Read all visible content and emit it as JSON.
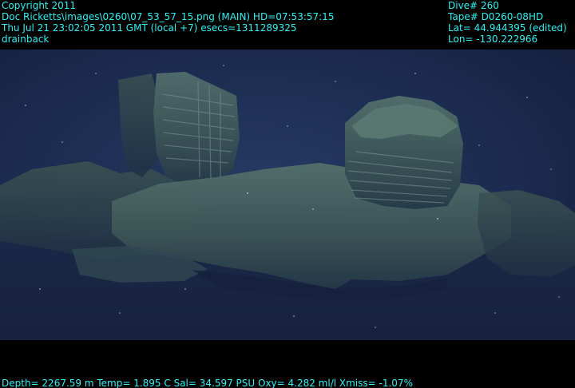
{
  "overlay": {
    "top_left": [
      "Copyright 2011",
      "Doc Ricketts\\images\\0260\\07_53_57_15.png (MAIN)  HD=07:53:57:15",
      "Thu Jul 21 23:02:05 2011 GMT (local +7)  esecs=1311289325",
      "drainback"
    ],
    "top_right": [
      "Dive# 260",
      "Tape# D0260-08HD",
      "Lat= 44.944395 (edited)",
      "Lon= -130.222966"
    ],
    "bottom": "Depth= 2267.59 m  Temp= 1.895 C  Sal= 34.597 PSU  Oxy= 4.282 ml/l  Xmiss= -1.07%"
  },
  "colors": {
    "overlay_text": "#33f0f0",
    "letterbox": "#000000",
    "water": "#1b2a4e",
    "rock": "#3f5a5a"
  }
}
